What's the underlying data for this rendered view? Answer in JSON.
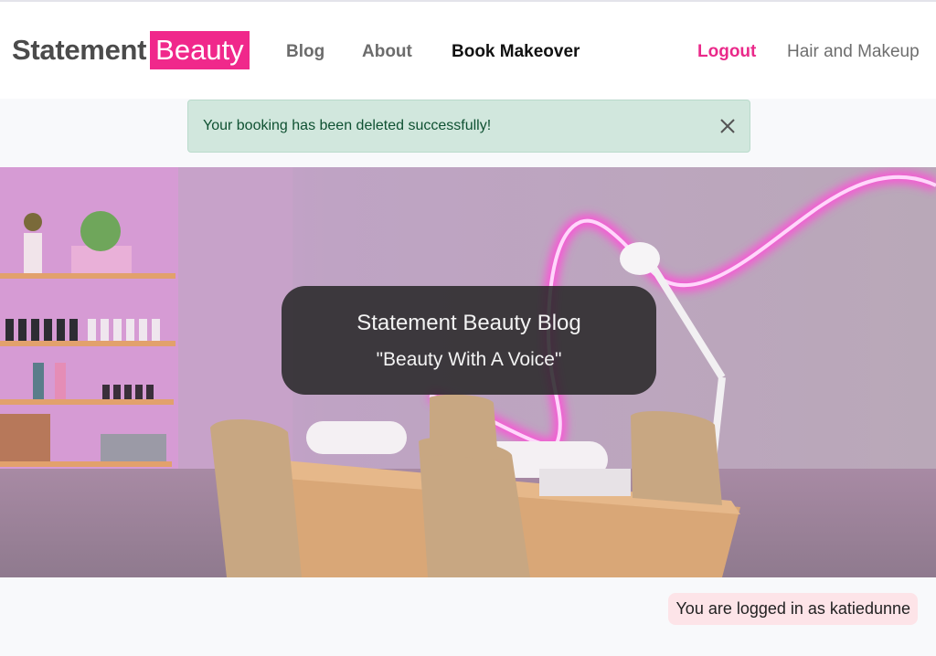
{
  "brand": {
    "main": "Statement",
    "accent": "Beauty",
    "accent_color": "#f0288b"
  },
  "nav": {
    "blog": "Blog",
    "about": "About",
    "book": "Book Makeover",
    "logout": "Logout",
    "hair_makeup": "Hair and Makeup"
  },
  "alert": {
    "message": "Your booking has been deleted successfully!",
    "close_icon": "close-icon"
  },
  "hero": {
    "title": "Statement Beauty Blog",
    "subtitle": "\"Beauty With A Voice\"",
    "image": "nail-salon-photo"
  },
  "footer": {
    "status": "You are logged in as katiedunne"
  },
  "colors": {
    "accent": "#f0288b",
    "alert_bg": "#d1e7dd",
    "badge_bg": "#fde4e8"
  }
}
